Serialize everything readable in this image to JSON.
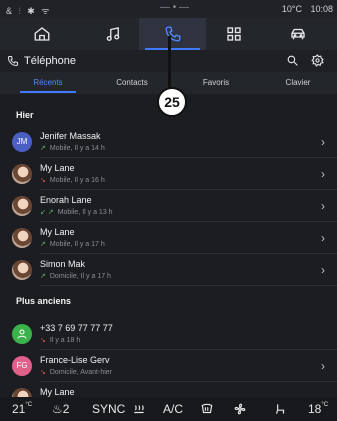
{
  "status": {
    "left_icons": "& ⫶ ✱ ᯤ",
    "temperature": "10°C",
    "time": "10:08"
  },
  "nav": {
    "items": [
      {
        "icon": "home-icon"
      },
      {
        "icon": "music-icon"
      },
      {
        "icon": "phone-icon",
        "active": true
      },
      {
        "icon": "apps-icon"
      },
      {
        "icon": "car-icon"
      }
    ]
  },
  "header": {
    "title": "Téléphone"
  },
  "tabs": [
    {
      "label": "Récents",
      "active": true
    },
    {
      "label": "Contacts"
    },
    {
      "label": "Favoris"
    },
    {
      "label": "Clavier"
    }
  ],
  "callout": {
    "label": "25"
  },
  "sections": {
    "yesterday": "Hier",
    "older": "Plus anciens"
  },
  "calls_yesterday": [
    {
      "name": "Jenifer Massak",
      "initials": "JM",
      "avatar_color": "#4a5fc1",
      "sub": "Mobile, Il y a 14 h"
    },
    {
      "name": "My Lane",
      "initials": "",
      "photo": true,
      "sub": "Mobile, Il y a 16 h"
    },
    {
      "name": "Enorah Lane",
      "initials": "",
      "photo": true,
      "sub": "Mobile, Il y a 13 h"
    },
    {
      "name": "My Lane",
      "initials": "",
      "photo": true,
      "sub": "Mobile, Il y a 17 h"
    },
    {
      "name": "Simon Mak",
      "initials": "",
      "photo": true,
      "sub": "Domicile, Il y a 17 h"
    }
  ],
  "calls_older": [
    {
      "name": "+33 7 69 77 77 77",
      "initials": "",
      "avatar_color": "#3bb24a",
      "sub": "Il y a 18 h"
    },
    {
      "name": "France-Lise Gerv",
      "initials": "FG",
      "avatar_color": "#e0608a",
      "sub": "Domicile, Avant-hier"
    },
    {
      "name": "My Lane",
      "initials": "",
      "photo": true,
      "sub": ""
    }
  ],
  "climate": {
    "temp_left": "21",
    "temp_unit": "°C",
    "seat_level": "2",
    "sync": "SYNC",
    "ac": "A/C",
    "temp_right": "18"
  }
}
